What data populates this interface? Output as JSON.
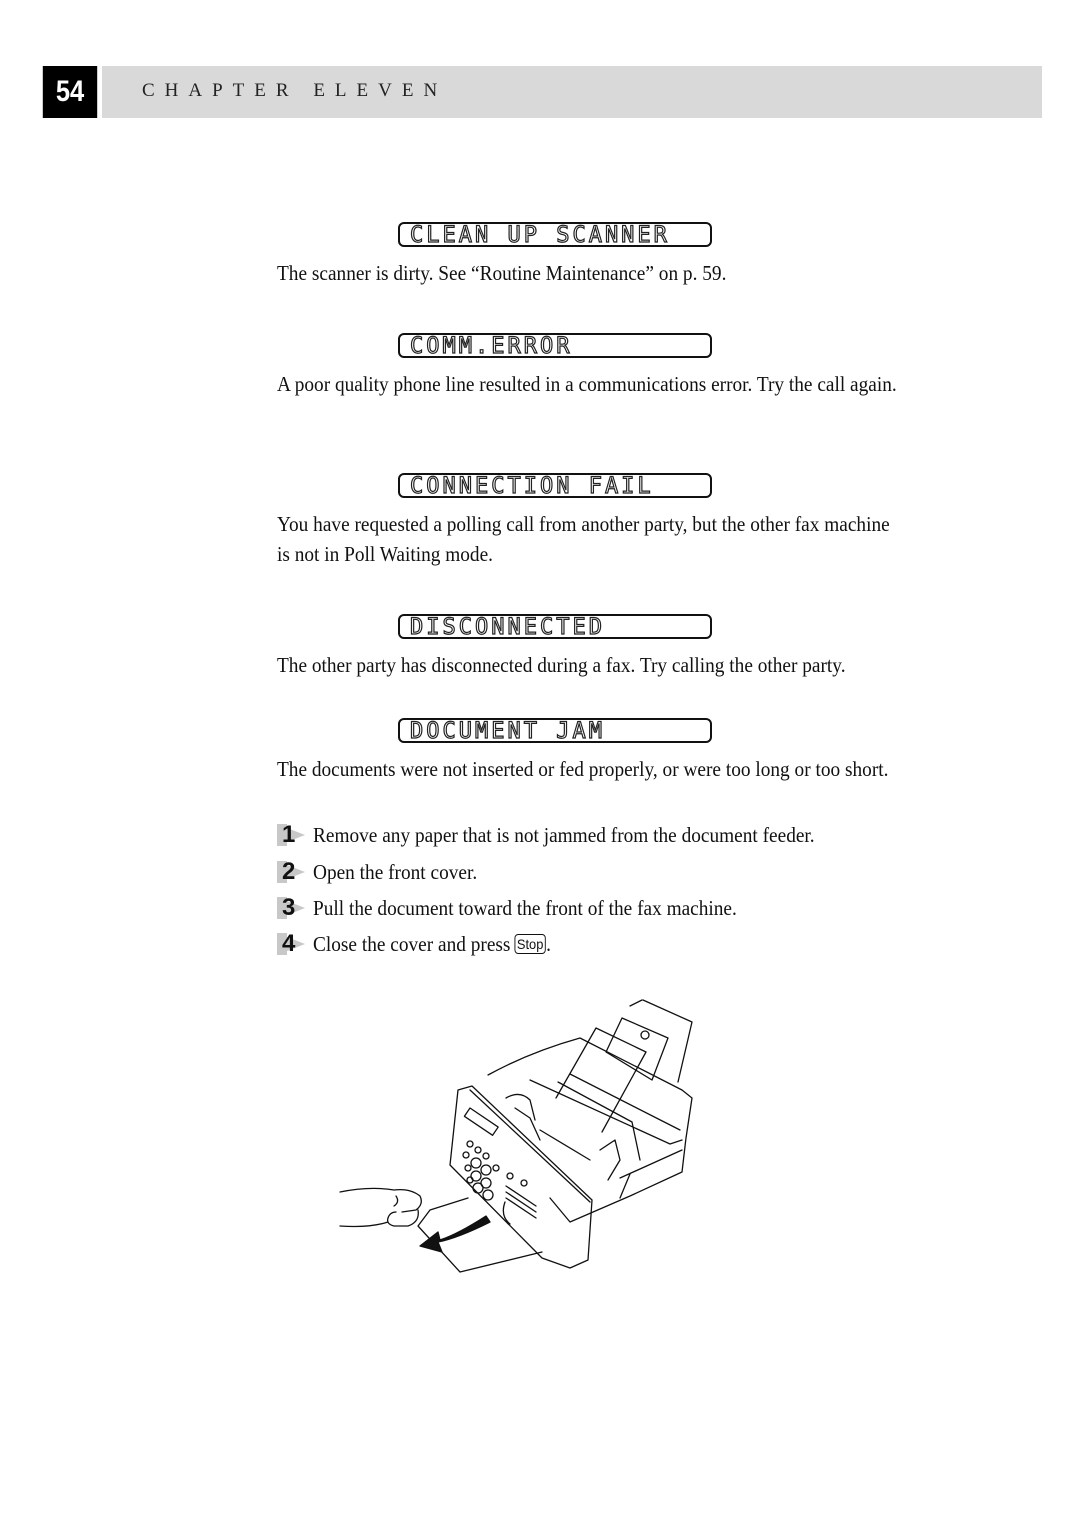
{
  "header": {
    "page_number": "54",
    "chapter_title": "CHAPTER ELEVEN"
  },
  "messages": [
    {
      "lcd": "CLEAN UP SCANNER",
      "description": "The scanner is dirty. See “Routine Maintenance” on p. 59."
    },
    {
      "lcd": "COMM.ERROR",
      "description": "A poor quality phone line resulted in a communications error. Try the call again."
    },
    {
      "lcd": "CONNECTION FAIL",
      "description": "You have requested a polling call from another party, but the other fax machine is not in Poll Waiting mode."
    },
    {
      "lcd": "DISCONNECTED",
      "description": "The other party has disconnected during a fax. Try calling the other party."
    },
    {
      "lcd": "DOCUMENT JAM",
      "description": "The documents were not inserted or fed properly, or were too long or too short."
    }
  ],
  "steps": [
    {
      "number": "1",
      "text": "Remove any paper that is not jammed from the document feeder."
    },
    {
      "number": "2",
      "text": "Open the front cover."
    },
    {
      "number": "3",
      "text": "Pull the document toward the front of the fax machine."
    },
    {
      "number": "4",
      "text": "Close the cover and press",
      "key": "Stop",
      "suffix": "."
    }
  ],
  "illustration": {
    "subject": "fax machine with open front cover, hand pulling jammed document out",
    "icon": "fax-document-jam-illustration"
  }
}
